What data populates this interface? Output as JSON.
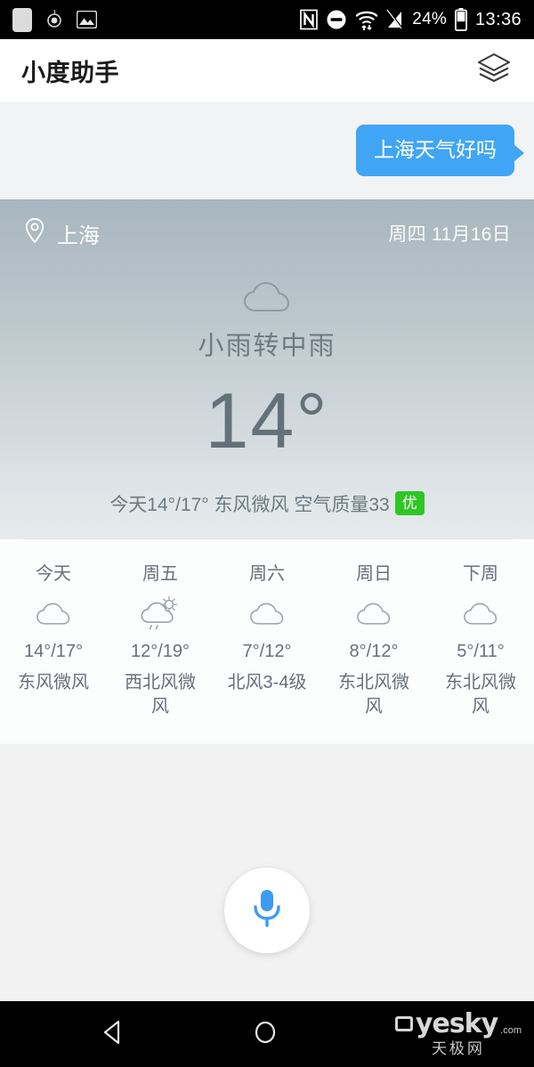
{
  "statusbar": {
    "left_icons": [
      "notification-box-icon",
      "app-badge-icon",
      "gallery-icon"
    ],
    "nfc_label": "N",
    "dnd_icon": "do-not-disturb-icon",
    "wifi_icon": "wifi-icon",
    "signal_icon": "signal-no-service-icon",
    "battery_percent": "24%",
    "battery_icon": "battery-icon",
    "time": "13:36"
  },
  "appbar": {
    "title": "小度助手",
    "right_icon": "layers-icon"
  },
  "chat": {
    "messages": [
      {
        "sender": "user",
        "text": "上海天气好吗"
      }
    ]
  },
  "weather": {
    "location": "上海",
    "location_icon": "location-pin-icon",
    "date": "周四 11月16日",
    "condition_icon": "cloud-icon",
    "condition": "小雨转中雨",
    "temperature": "14°",
    "detail": "今天14°/17° 东风微风 空气质量33",
    "aqi_badge": "优",
    "aqi_badge_color": "#2fc625",
    "forecast": [
      {
        "day": "今天",
        "icon": "cloud-icon",
        "temp": "14°/17°",
        "wind": "东风微风"
      },
      {
        "day": "周五",
        "icon": "sun-cloud-rain-icon",
        "temp": "12°/19°",
        "wind": "西北风微风"
      },
      {
        "day": "周六",
        "icon": "cloud-icon",
        "temp": "7°/12°",
        "wind": "北风3-4级"
      },
      {
        "day": "周日",
        "icon": "cloud-icon",
        "temp": "8°/12°",
        "wind": "东北风微风"
      },
      {
        "day": "下周",
        "icon": "cloud-icon",
        "temp": "5°/11°",
        "wind": "东北风微风"
      }
    ]
  },
  "mic": {
    "icon": "microphone-icon",
    "color": "#3d9bf0"
  },
  "navbar": {
    "back_icon": "back-triangle-icon",
    "home_icon": "home-circle-icon",
    "watermark_text": "yesky",
    "watermark_suffix": ".com",
    "watermark_sub": "天极网"
  }
}
